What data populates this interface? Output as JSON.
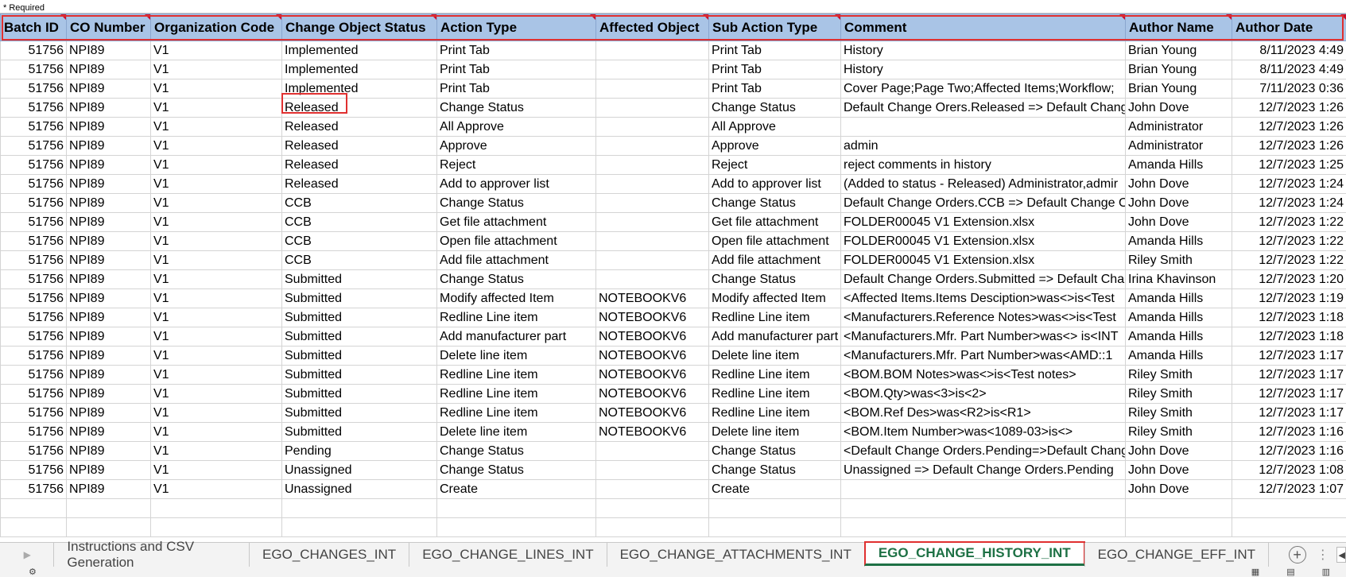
{
  "required_note": "* Required",
  "columns": [
    "Batch ID",
    "CO Number",
    "Organization Code",
    "Change Object Status",
    "Action Type",
    "Affected Object",
    "Sub Action Type",
    "Comment",
    "Author Name",
    "Author Date"
  ],
  "rows": [
    [
      "51756",
      "NPI89",
      "V1",
      "Implemented",
      "Print Tab",
      "",
      "Print Tab",
      "History",
      "Brian Young",
      "8/11/2023 4:49"
    ],
    [
      "51756",
      "NPI89",
      "V1",
      "Implemented",
      "Print Tab",
      "",
      "Print Tab",
      "History",
      "Brian Young",
      "8/11/2023 4:49"
    ],
    [
      "51756",
      "NPI89",
      "V1",
      "Implemented",
      "Print Tab",
      "",
      "Print Tab",
      "Cover Page;Page Two;Affected Items;Workflow;",
      "Brian Young",
      "7/11/2023 0:36"
    ],
    [
      "51756",
      "NPI89",
      "V1",
      "Released",
      "Change Status",
      "",
      "Change Status",
      "Default Change Orers.Released => Default Chang",
      "John Dove",
      "12/7/2023 1:26"
    ],
    [
      "51756",
      "NPI89",
      "V1",
      "Released",
      "All Approve",
      "",
      "All Approve",
      "",
      "Administrator",
      "12/7/2023 1:26"
    ],
    [
      "51756",
      "NPI89",
      "V1",
      "Released",
      "Approve",
      "",
      "Approve",
      "admin",
      "Administrator",
      "12/7/2023 1:26"
    ],
    [
      "51756",
      "NPI89",
      "V1",
      "Released",
      "Reject",
      "",
      "Reject",
      "reject comments in history",
      "Amanda Hills",
      "12/7/2023 1:25"
    ],
    [
      "51756",
      "NPI89",
      "V1",
      "Released",
      "Add to approver list",
      "",
      "Add to approver list",
      "(Added to status - Released) Administrator,admir",
      "John Dove",
      "12/7/2023 1:24"
    ],
    [
      "51756",
      "NPI89",
      "V1",
      "CCB",
      "Change Status",
      "",
      "Change Status",
      "Default Change Orders.CCB => Default Change O",
      "John Dove",
      "12/7/2023 1:24"
    ],
    [
      "51756",
      "NPI89",
      "V1",
      "CCB",
      "Get file attachment",
      "",
      "Get file attachment",
      "FOLDER00045 V1 Extension.xlsx",
      "John Dove",
      "12/7/2023 1:22"
    ],
    [
      "51756",
      "NPI89",
      "V1",
      "CCB",
      "Open file attachment",
      "",
      "Open file attachment",
      "FOLDER00045 V1 Extension.xlsx",
      "Amanda Hills",
      "12/7/2023 1:22"
    ],
    [
      "51756",
      "NPI89",
      "V1",
      "CCB",
      "Add file attachment",
      "",
      "Add file attachment",
      "FOLDER00045 V1 Extension.xlsx",
      "Riley Smith",
      "12/7/2023 1:22"
    ],
    [
      "51756",
      "NPI89",
      "V1",
      "Submitted",
      "Change Status",
      "",
      "Change Status",
      "Default Change Orders.Submitted => Default Cha",
      "Irina Khavinson",
      "12/7/2023 1:20"
    ],
    [
      "51756",
      "NPI89",
      "V1",
      "Submitted",
      "Modify affected Item",
      "NOTEBOOKV6",
      "Modify affected Item",
      "<Affected Items.Items Desciption>was<>is<Test",
      "Amanda Hills",
      "12/7/2023 1:19"
    ],
    [
      "51756",
      "NPI89",
      "V1",
      "Submitted",
      "Redline Line item",
      "NOTEBOOKV6",
      "Redline Line item",
      "<Manufacturers.Reference Notes>was<>is<Test",
      "Amanda Hills",
      "12/7/2023 1:18"
    ],
    [
      "51756",
      "NPI89",
      "V1",
      "Submitted",
      "Add manufacturer part",
      "NOTEBOOKV6",
      "Add manufacturer part",
      "<Manufacturers.Mfr. Part Number>was<> is<INT",
      "Amanda Hills",
      "12/7/2023 1:18"
    ],
    [
      "51756",
      "NPI89",
      "V1",
      "Submitted",
      "Delete line item",
      "NOTEBOOKV6",
      "Delete line item",
      "<Manufacturers.Mfr. Part Number>was<AMD::1",
      "Amanda Hills",
      "12/7/2023 1:17"
    ],
    [
      "51756",
      "NPI89",
      "V1",
      "Submitted",
      "Redline Line item",
      "NOTEBOOKV6",
      "Redline Line item",
      "<BOM.BOM Notes>was<>is<Test notes>",
      "Riley Smith",
      "12/7/2023 1:17"
    ],
    [
      "51756",
      "NPI89",
      "V1",
      "Submitted",
      "Redline Line item",
      "NOTEBOOKV6",
      "Redline Line item",
      "<BOM.Qty>was<3>is<2>",
      "Riley Smith",
      "12/7/2023 1:17"
    ],
    [
      "51756",
      "NPI89",
      "V1",
      "Submitted",
      "Redline Line item",
      "NOTEBOOKV6",
      "Redline Line item",
      "<BOM.Ref Des>was<R2>is<R1>",
      "Riley Smith",
      "12/7/2023 1:17"
    ],
    [
      "51756",
      "NPI89",
      "V1",
      "Submitted",
      "Delete line item",
      "NOTEBOOKV6",
      "Delete line item",
      "<BOM.Item Number>was<1089-03>is<>",
      "Riley Smith",
      "12/7/2023 1:16"
    ],
    [
      "51756",
      "NPI89",
      "V1",
      "Pending",
      "Change Status",
      "",
      "Change Status",
      "<Default Change Orders.Pending=>Default Chang",
      "John Dove",
      "12/7/2023 1:16"
    ],
    [
      "51756",
      "NPI89",
      "V1",
      "Unassigned",
      "Change Status",
      "",
      "Change Status",
      "Unassigned => Default Change Orders.Pending",
      "John Dove",
      "12/7/2023 1:08"
    ],
    [
      "51756",
      "NPI89",
      "V1",
      "Unassigned",
      "Create",
      "",
      "Create",
      "",
      "John Dove",
      "12/7/2023 1:07"
    ]
  ],
  "sheet_tabs": [
    "Instructions and CSV Generation",
    "EGO_CHANGES_INT",
    "EGO_CHANGE_LINES_INT",
    "EGO_CHANGE_ATTACHMENTS_INT",
    "EGO_CHANGE_HISTORY_INT",
    "EGO_CHANGE_EFF_INT"
  ],
  "active_tab": "EGO_CHANGE_HISTORY_INT",
  "colors": {
    "header_bg": "#a9c4e6",
    "highlight": "#e03030",
    "active_tab_text": "#1e7145"
  }
}
